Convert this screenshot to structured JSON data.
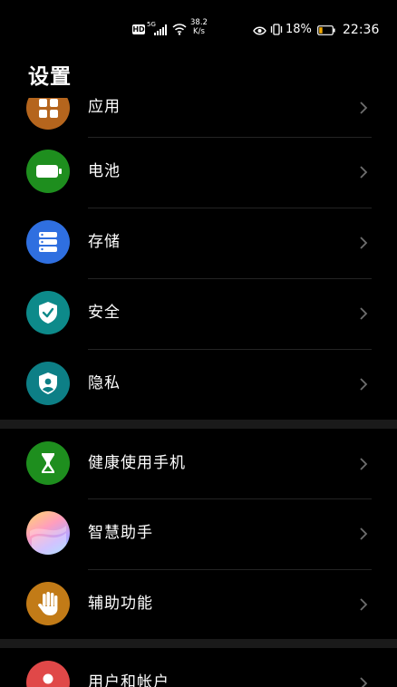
{
  "status_bar": {
    "hd_badge": "HD",
    "network_type": "5G",
    "speed_value": "38.2",
    "speed_unit": "K/s",
    "battery_percent": "18%",
    "time": "22:36"
  },
  "header": {
    "title": "设置"
  },
  "colors": {
    "background": "#000000",
    "separator": "#242424",
    "section_gap": "#1a1a1a",
    "battery_low": "#f2a900"
  },
  "items": [
    {
      "label": "应用",
      "icon": "apps-icon",
      "color": "#b5651d"
    },
    {
      "label": "电池",
      "icon": "battery-icon",
      "color": "#1e8e1e"
    },
    {
      "label": "存储",
      "icon": "storage-icon",
      "color": "#2f6fe0"
    },
    {
      "label": "安全",
      "icon": "shield-check-icon",
      "color": "#0d8a8a"
    },
    {
      "label": "隐私",
      "icon": "privacy-shield-icon",
      "color": "#0d7f86"
    },
    {
      "label": "健康使用手机",
      "icon": "hourglass-icon",
      "color": "#1e8e1e"
    },
    {
      "label": "智慧助手",
      "icon": "smart-assistant-icon",
      "color": "#ff9ebd"
    },
    {
      "label": "辅助功能",
      "icon": "hand-icon",
      "color": "#c27b17"
    },
    {
      "label": "用户和帐户",
      "icon": "user-icon",
      "color": "#e04848"
    }
  ]
}
